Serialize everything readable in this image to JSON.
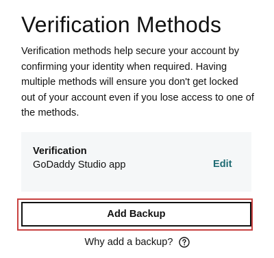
{
  "header": {
    "title": "Verification Methods"
  },
  "intro": {
    "description": "Verification methods help secure your account by confirming your identity when required. Having multiple methods will ensure you don't get locked out of your account even if you lose access to one of the methods."
  },
  "method": {
    "type_label": "Verification",
    "name": "GoDaddy Studio app",
    "edit_label": "Edit"
  },
  "actions": {
    "add_backup_label": "Add Backup",
    "why_label": "Why add a backup?",
    "help_icon": "question-circle-icon"
  },
  "colors": {
    "accent_link": "#1f6b73",
    "highlight": "#c8403f",
    "card_background": "#f5f7f8"
  }
}
